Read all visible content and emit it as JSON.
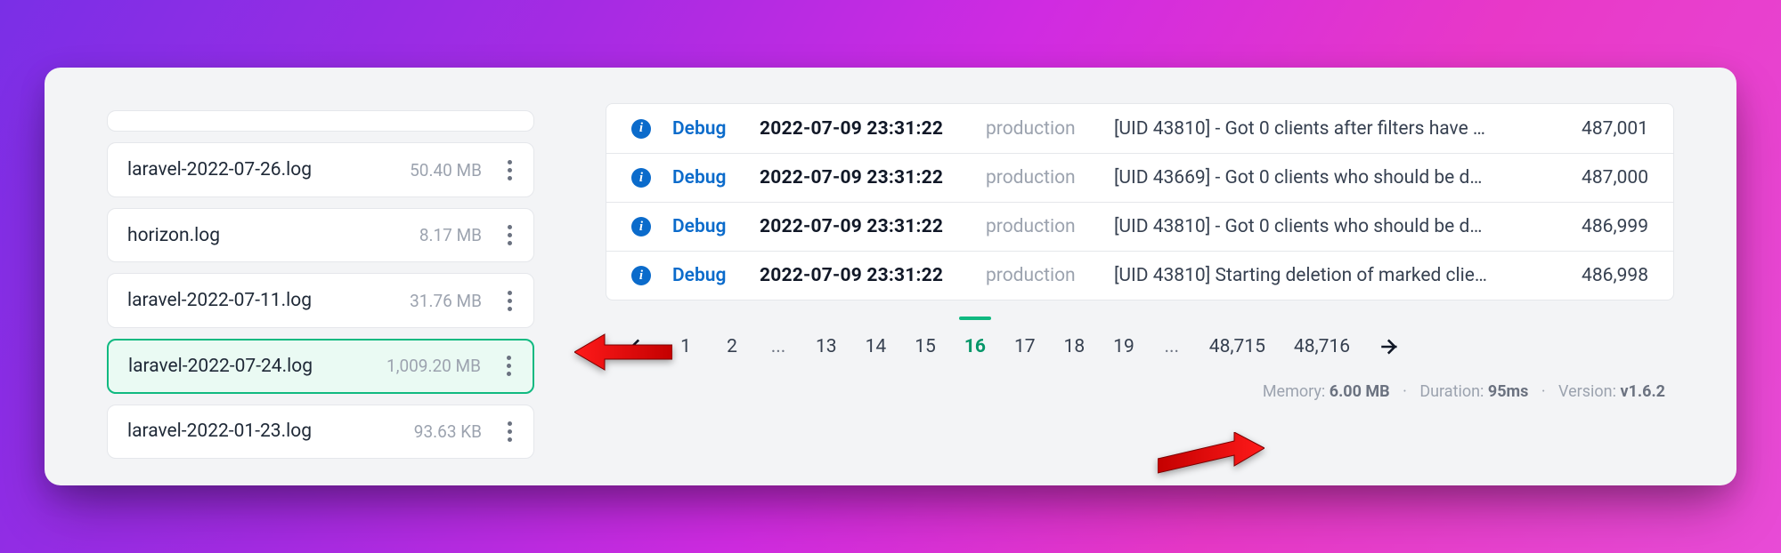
{
  "sidebar": {
    "files": [
      {
        "name": "laravel-2022-07-26.log",
        "size": "50.40 MB",
        "selected": false,
        "placeholder": false
      },
      {
        "name": "horizon.log",
        "size": "8.17 MB",
        "selected": false,
        "placeholder": false
      },
      {
        "name": "laravel-2022-07-11.log",
        "size": "31.76 MB",
        "selected": false,
        "placeholder": false
      },
      {
        "name": "laravel-2022-07-24.log",
        "size": "1,009.20 MB",
        "selected": true,
        "placeholder": false
      },
      {
        "name": "laravel-2022-01-23.log",
        "size": "93.63 KB",
        "selected": false,
        "placeholder": false
      }
    ]
  },
  "logs": {
    "rows": [
      {
        "level": "Debug",
        "ts": "2022-07-09 23:31:22",
        "env": "production",
        "msg": "[UID 43810] - Got 0 clients after filters have …",
        "line": "487,001"
      },
      {
        "level": "Debug",
        "ts": "2022-07-09 23:31:22",
        "env": "production",
        "msg": "[UID 43669] - Got 0 clients who should be d…",
        "line": "487,000"
      },
      {
        "level": "Debug",
        "ts": "2022-07-09 23:31:22",
        "env": "production",
        "msg": "[UID 43810] - Got 0 clients who should be d…",
        "line": "486,999"
      },
      {
        "level": "Debug",
        "ts": "2022-07-09 23:31:22",
        "env": "production",
        "msg": "[UID 43810] Starting deletion of marked clie…",
        "line": "486,998"
      }
    ]
  },
  "pagination": {
    "pages": [
      "1",
      "2",
      "...",
      "13",
      "14",
      "15",
      "16",
      "17",
      "18",
      "19",
      "...",
      "48,715",
      "48,716"
    ],
    "current": "16"
  },
  "footer": {
    "memory_label": "Memory: ",
    "memory_value": "6.00 MB",
    "duration_label": "Duration: ",
    "duration_value": "95ms",
    "version_label": "Version: ",
    "version_value": "v1.6.2"
  }
}
